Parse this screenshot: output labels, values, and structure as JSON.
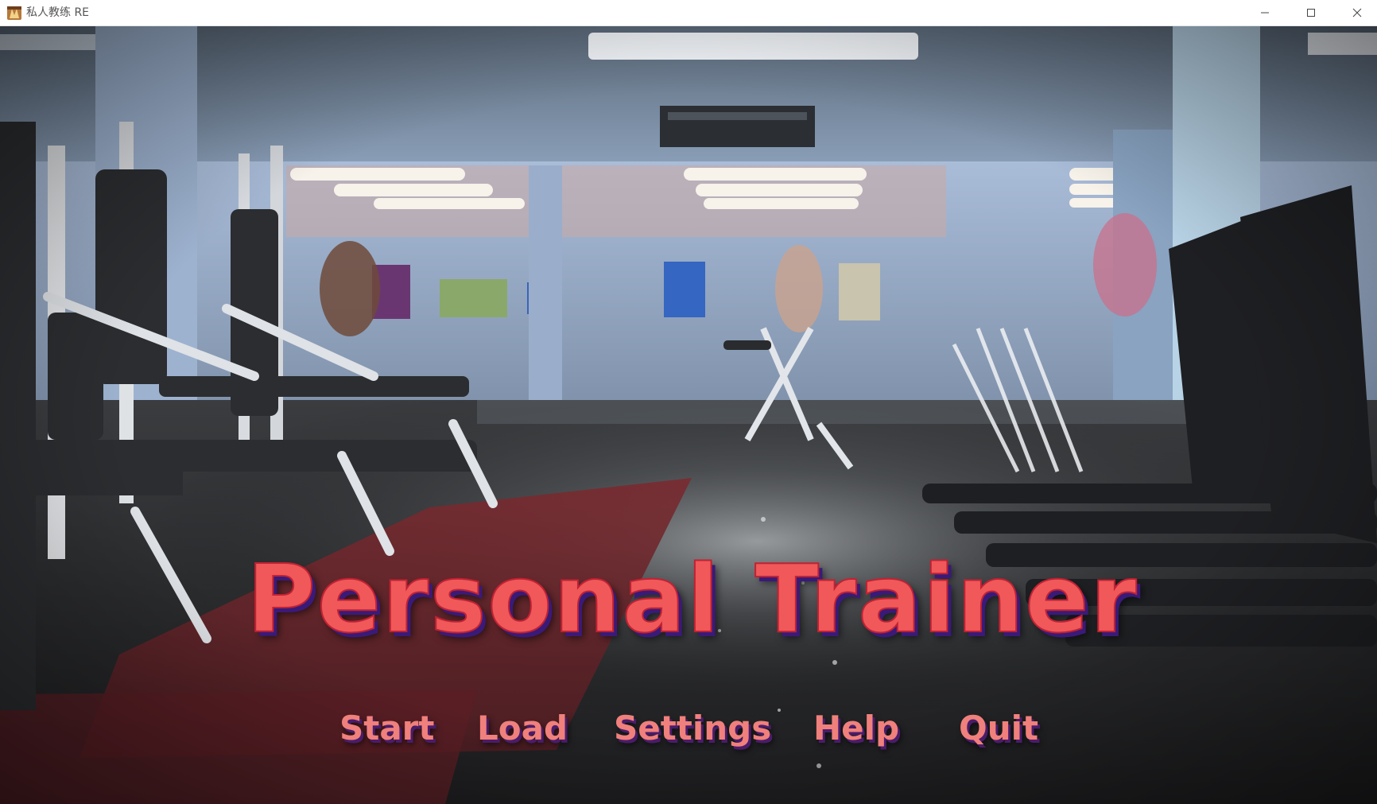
{
  "window": {
    "title": "私人教练 RE",
    "app_icon": "game-app-icon",
    "controls": {
      "minimize": "minimize-icon",
      "maximize": "maximize-icon",
      "close": "close-icon"
    }
  },
  "game": {
    "title": "Personal Trainer",
    "background": "gym-interior-scene",
    "menu": [
      {
        "id": "start",
        "label": "Start"
      },
      {
        "id": "load",
        "label": "Load"
      },
      {
        "id": "settings",
        "label": "Settings"
      },
      {
        "id": "help",
        "label": "Help"
      },
      {
        "id": "quit",
        "label": "Quit"
      }
    ]
  },
  "colors": {
    "title_fill": "#f0585a",
    "title_shadow": "#3a1a78",
    "menu_text": "#f0807c",
    "titlebar_bg": "#ffffff"
  }
}
